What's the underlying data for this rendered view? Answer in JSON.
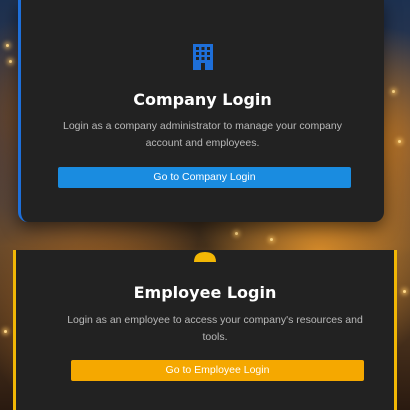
{
  "company_card": {
    "icon": "building-icon",
    "accent_color": "#1e6fd9",
    "title": "Company Login",
    "description": "Login as a company administrator to manage your company account and employees.",
    "button_label": "Go to Company Login",
    "button_color": "#1a8ce0"
  },
  "employee_card": {
    "icon": "person-icon",
    "accent_color": "#f2b705",
    "title": "Employee Login",
    "description": "Login as an employee to access your company's resources and tools.",
    "button_label": "Go to Employee Login",
    "button_color": "#f5a800"
  },
  "card_background": "#222222"
}
